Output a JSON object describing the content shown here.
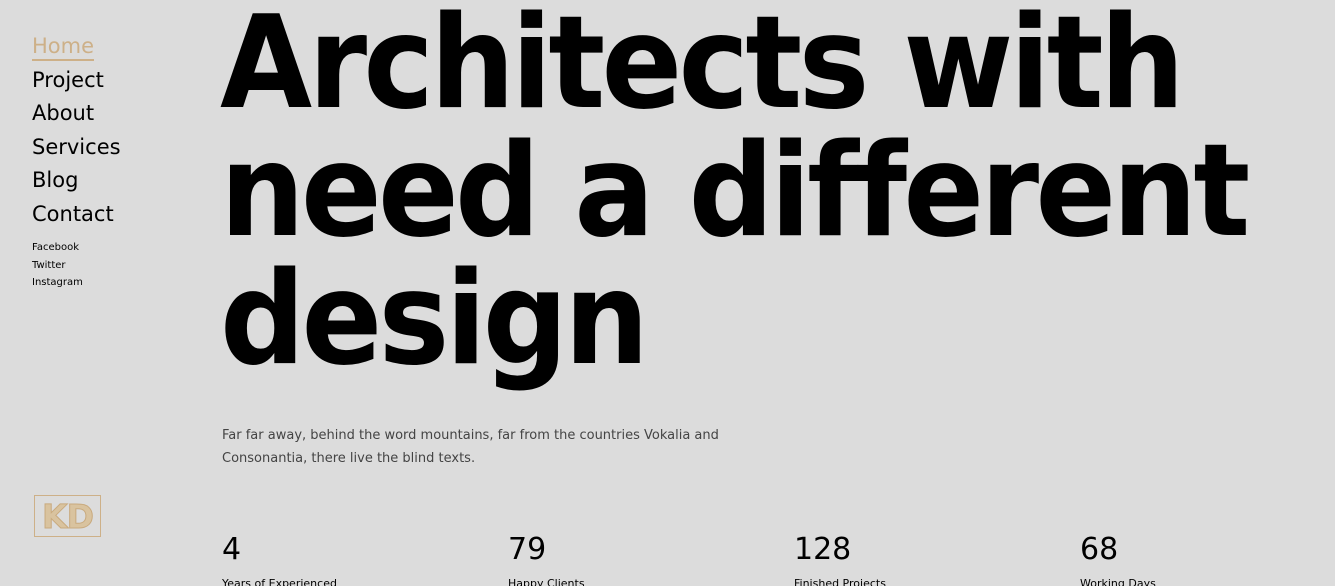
{
  "sidebar": {
    "nav": [
      {
        "label": "Home",
        "active": true
      },
      {
        "label": "Project",
        "active": false
      },
      {
        "label": "About",
        "active": false
      },
      {
        "label": "Services",
        "active": false
      },
      {
        "label": "Blog",
        "active": false
      },
      {
        "label": "Contact",
        "active": false
      }
    ],
    "social": [
      {
        "label": "Facebook"
      },
      {
        "label": "Twitter"
      },
      {
        "label": "Instagram"
      }
    ],
    "logo": "KD"
  },
  "hero": {
    "lines": [
      "Architects with",
      "need a different",
      "design"
    ],
    "description_line1": "Far far away, behind the word mountains, far from the countries Vokalia and",
    "description_line2": "Consonantia, there live the blind texts."
  },
  "stats": [
    {
      "value": "4",
      "label": "Years of Experienced"
    },
    {
      "value": "79",
      "label": "Happy Clients"
    },
    {
      "value": "128",
      "label": "Finished Projects"
    },
    {
      "value": "68",
      "label": "Working Days"
    }
  ],
  "colors": {
    "background": "#dcdcdc",
    "accent": "#cdb088",
    "text": "#000000"
  }
}
